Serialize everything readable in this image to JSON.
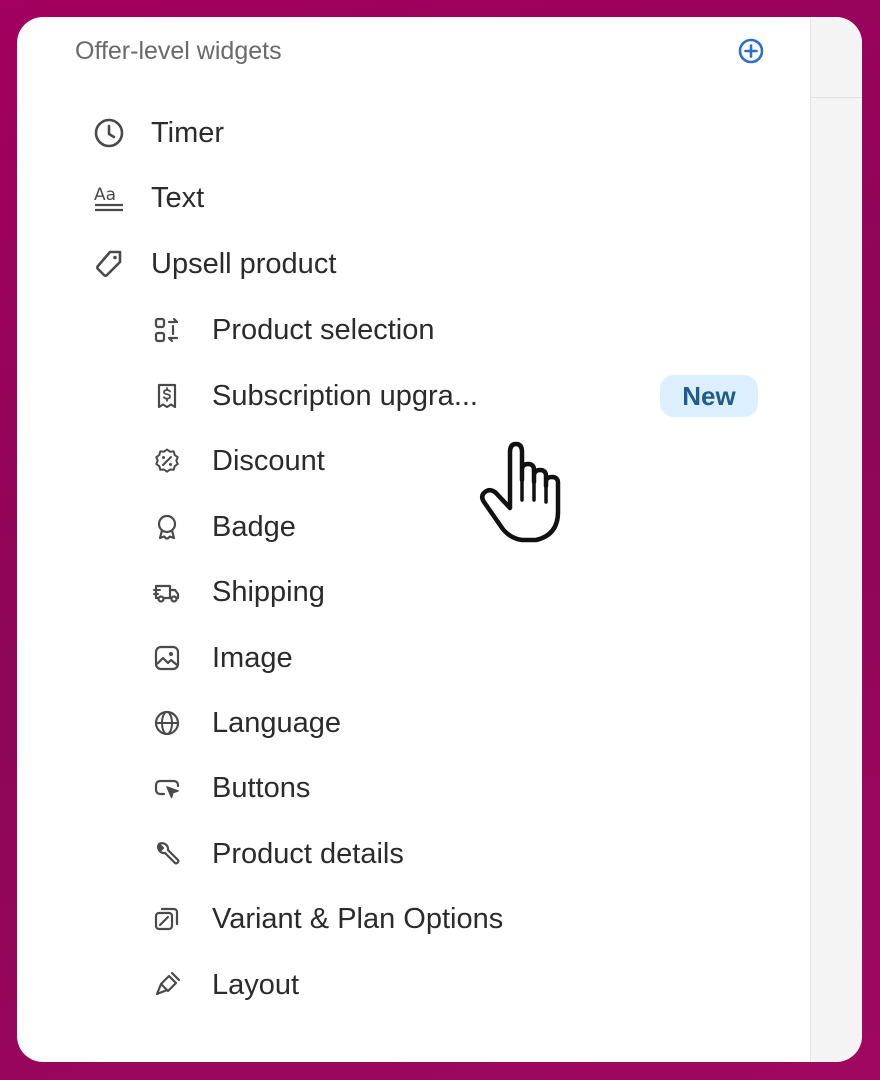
{
  "panel": {
    "section_title": "Offer-level widgets",
    "add_icon": "plus-circle-icon",
    "accent_color": "#2c6ecb"
  },
  "top_items": [
    {
      "label": "Timer",
      "icon": "clock-icon"
    },
    {
      "label": "Text",
      "icon": "text-style-icon"
    },
    {
      "label": "Upsell product",
      "icon": "tag-icon"
    }
  ],
  "sub_items": [
    {
      "label": "Product selection",
      "icon": "swap-grid-icon"
    },
    {
      "label": "Subscription upgra...",
      "icon": "receipt-dollar-icon",
      "badge": "New"
    },
    {
      "label": "Discount",
      "icon": "discount-icon"
    },
    {
      "label": "Badge",
      "icon": "ribbon-badge-icon"
    },
    {
      "label": "Shipping",
      "icon": "delivery-truck-icon"
    },
    {
      "label": "Image",
      "icon": "image-icon"
    },
    {
      "label": "Language",
      "icon": "globe-icon"
    },
    {
      "label": "Buttons",
      "icon": "button-cursor-icon"
    },
    {
      "label": "Product details",
      "icon": "wrench-icon"
    },
    {
      "label": "Variant & Plan Options",
      "icon": "variant-icon"
    },
    {
      "label": "Layout",
      "icon": "paintbrush-icon"
    }
  ],
  "colors": {
    "background": "#9a0660",
    "badge_bg": "#dcefff",
    "badge_text": "#215c8a",
    "label_text": "#2b2b2b",
    "header_text": "#6a6a6a"
  },
  "cursor": "hand-pointer-icon"
}
